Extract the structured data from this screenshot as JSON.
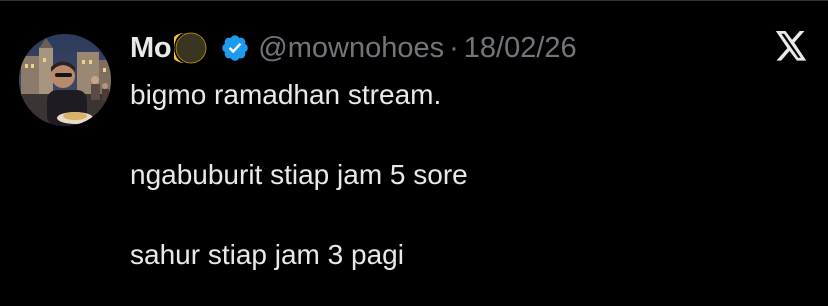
{
  "tweet": {
    "author": {
      "display_name": "Mo",
      "emoji_icon": "crescent-moon-icon",
      "verified_icon": "verified-badge-icon",
      "handle": "@mownohoes",
      "separator": "·",
      "date": "18/02/26"
    },
    "platform_icon": "x-logo-icon",
    "lines": [
      "bigmo ramadhan stream.",
      "ngabuburit stiap jam 5 sore",
      "sahur stiap jam 3 pagi"
    ]
  },
  "colors": {
    "background": "#000000",
    "text_primary": "#e7e9ea",
    "text_secondary": "#71767b",
    "verified_blue": "#1d9bf0",
    "moon_yellow": "#f4c430",
    "border": "#2f3336"
  }
}
